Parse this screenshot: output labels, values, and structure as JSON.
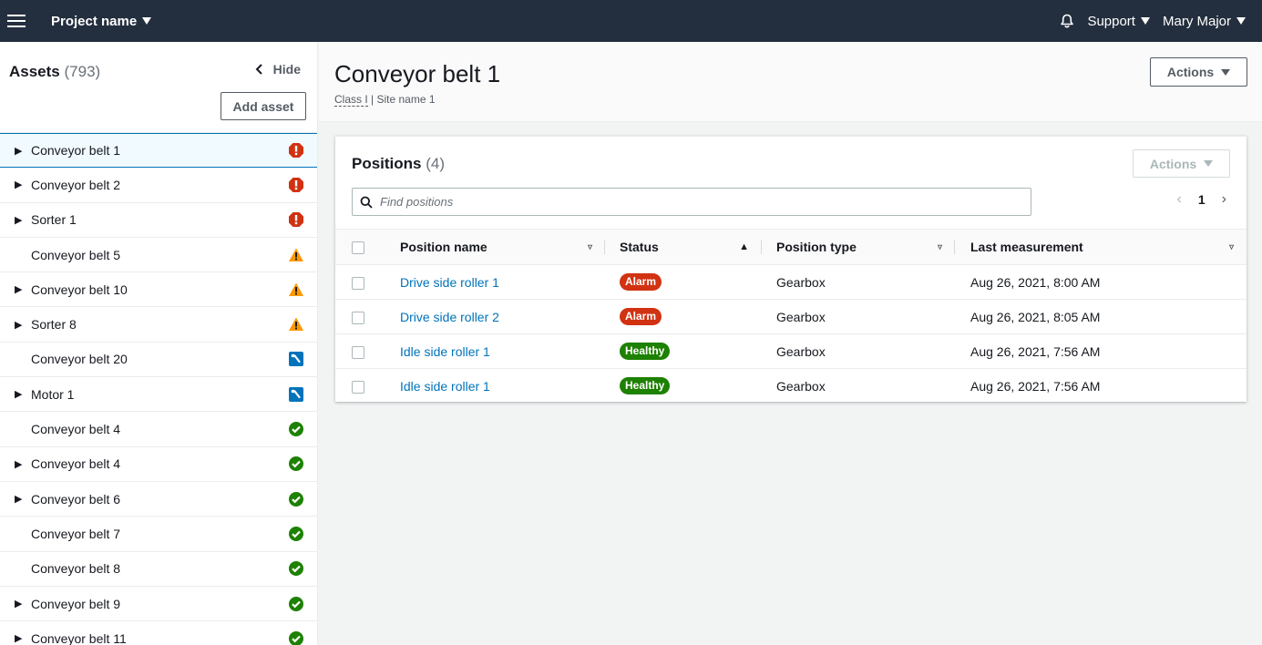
{
  "topnav": {
    "project_name": "Project name",
    "support_label": "Support",
    "user_name": "Mary Major"
  },
  "sidebar": {
    "title": "Assets",
    "count": "(793)",
    "hide_label": "Hide",
    "add_asset_label": "Add asset",
    "items": [
      {
        "label": "Conveyor belt 1",
        "expandable": true,
        "status": "critical",
        "selected": true
      },
      {
        "label": "Conveyor belt 2",
        "expandable": true,
        "status": "critical"
      },
      {
        "label": "Sorter 1",
        "expandable": true,
        "status": "critical"
      },
      {
        "label": "Conveyor belt 5",
        "expandable": false,
        "status": "warning"
      },
      {
        "label": "Conveyor belt 10",
        "expandable": true,
        "status": "warning"
      },
      {
        "label": "Sorter 8",
        "expandable": true,
        "status": "warning"
      },
      {
        "label": "Conveyor belt 20",
        "expandable": false,
        "status": "maintenance"
      },
      {
        "label": "Motor 1",
        "expandable": true,
        "status": "maintenance"
      },
      {
        "label": "Conveyor belt 4",
        "expandable": false,
        "status": "ok"
      },
      {
        "label": "Conveyor belt 4",
        "expandable": true,
        "status": "ok"
      },
      {
        "label": "Conveyor belt 6",
        "expandable": true,
        "status": "ok"
      },
      {
        "label": "Conveyor belt 7",
        "expandable": false,
        "status": "ok"
      },
      {
        "label": "Conveyor belt 8",
        "expandable": false,
        "status": "ok"
      },
      {
        "label": "Conveyor belt 9",
        "expandable": true,
        "status": "ok"
      },
      {
        "label": "Conveyor belt 11",
        "expandable": true,
        "status": "ok"
      }
    ]
  },
  "main": {
    "title": "Conveyor belt 1",
    "class_label": "Class I",
    "site_label": "| Site name 1",
    "actions_label": "Actions"
  },
  "positions": {
    "title": "Positions",
    "count": "(4)",
    "actions_label": "Actions",
    "search_placeholder": "Find positions",
    "page": "1",
    "columns": [
      "Position name",
      "Status",
      "Position type",
      "Last measurement"
    ],
    "rows": [
      {
        "name": "Drive side roller 1",
        "status": "Alarm",
        "type": "Gearbox",
        "last": "Aug 26, 2021, 8:00 AM"
      },
      {
        "name": "Drive side roller 2",
        "status": "Alarm",
        "type": "Gearbox",
        "last": "Aug 26, 2021, 8:05 AM"
      },
      {
        "name": "Idle side roller 1",
        "status": "Healthy",
        "type": "Gearbox",
        "last": "Aug 26, 2021, 7:56 AM"
      },
      {
        "name": "Idle side roller 1",
        "status": "Healthy",
        "type": "Gearbox",
        "last": "Aug 26, 2021, 7:56 AM"
      }
    ]
  },
  "colors": {
    "nav_bg": "#232f3e",
    "critical": "#d13212",
    "warning": "#ff9900",
    "maintenance": "#0073bb",
    "ok": "#1d8102",
    "link": "#0073bb"
  }
}
